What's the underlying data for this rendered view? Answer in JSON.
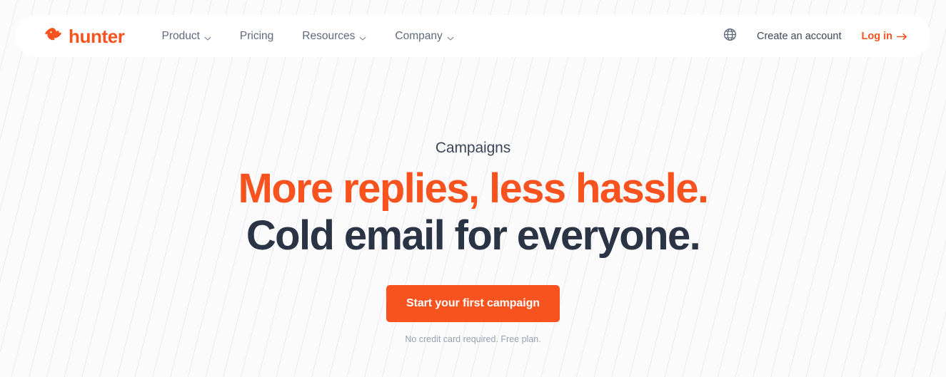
{
  "brand": {
    "name": "hunter",
    "logo_icon": "hunter-bird-mark",
    "accent_color": "#f8521f",
    "dark_color": "#2b3445"
  },
  "header": {
    "nav": [
      {
        "label": "Product",
        "has_chevron": true,
        "icon": "chevron-down-icon"
      },
      {
        "label": "Pricing",
        "has_chevron": false,
        "icon": ""
      },
      {
        "label": "Resources",
        "has_chevron": true,
        "icon": "chevron-down-icon"
      },
      {
        "label": "Company",
        "has_chevron": true,
        "icon": "chevron-down-icon"
      }
    ],
    "language_icon": "globe-icon",
    "create_account_label": "Create an account",
    "login_label": "Log in",
    "login_icon": "arrow-right-icon"
  },
  "hero": {
    "eyebrow": "Campaigns",
    "headline_line1": "More replies, less hassle.",
    "headline_line2": "Cold email for everyone.",
    "cta_label": "Start your first campaign",
    "disclaimer": "No credit card required. Free plan."
  }
}
